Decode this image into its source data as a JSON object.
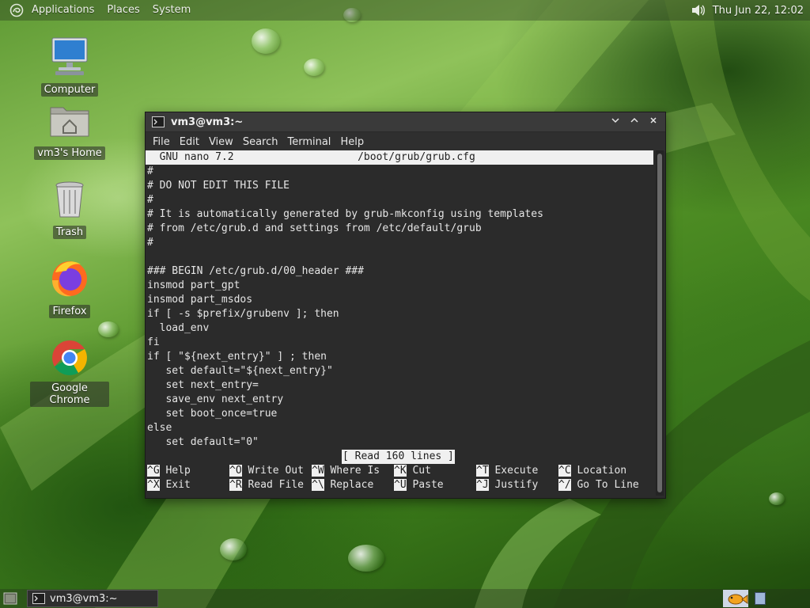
{
  "top_panel": {
    "menus": [
      "Applications",
      "Places",
      "System"
    ],
    "clock": "Thu Jun 22, 12:02",
    "icons": [
      "distro-icon",
      "volume-icon"
    ]
  },
  "desktop": {
    "icons": [
      {
        "label": "Computer",
        "icon": "computer-icon"
      },
      {
        "label": "vm3's Home",
        "icon": "home-folder-icon"
      },
      {
        "label": "Trash",
        "icon": "trash-icon"
      },
      {
        "label": "Firefox",
        "icon": "firefox-icon"
      },
      {
        "label": "Google Chrome",
        "icon": "chrome-icon"
      }
    ]
  },
  "window": {
    "title": "vm3@vm3:~",
    "menu": [
      "File",
      "Edit",
      "View",
      "Search",
      "Terminal",
      "Help"
    ],
    "controls": [
      "minimize-icon",
      "maximize-icon",
      "close-icon"
    ]
  },
  "nano": {
    "header": "  GNU nano 7.2                    /boot/grub/grub.cfg",
    "lines": [
      "#",
      "# DO NOT EDIT THIS FILE",
      "#",
      "# It is automatically generated by grub-mkconfig using templates",
      "# from /etc/grub.d and settings from /etc/default/grub",
      "#",
      "",
      "### BEGIN /etc/grub.d/00_header ###",
      "insmod part_gpt",
      "insmod part_msdos",
      "if [ -s $prefix/grubenv ]; then",
      "  load_env",
      "fi",
      "if [ \"${next_entry}\" ] ; then",
      "   set default=\"${next_entry}\"",
      "   set next_entry=",
      "   save_env next_entry",
      "   set boot_once=true",
      "else",
      "   set default=\"0\""
    ],
    "status": "[ Read 160 lines ]",
    "shortcuts": [
      {
        "key": "^G",
        "label": "Help"
      },
      {
        "key": "^O",
        "label": "Write Out"
      },
      {
        "key": "^W",
        "label": "Where Is"
      },
      {
        "key": "^K",
        "label": "Cut"
      },
      {
        "key": "^T",
        "label": "Execute"
      },
      {
        "key": "^C",
        "label": "Location"
      },
      {
        "key": "^X",
        "label": "Exit"
      },
      {
        "key": "^R",
        "label": "Read File"
      },
      {
        "key": "^\\",
        "label": "Replace"
      },
      {
        "key": "^U",
        "label": "Paste"
      },
      {
        "key": "^J",
        "label": "Justify"
      },
      {
        "key": "^/",
        "label": "Go To Line"
      }
    ]
  },
  "taskbar": {
    "tasks": [
      {
        "label": "vm3@vm3:~"
      }
    ]
  }
}
